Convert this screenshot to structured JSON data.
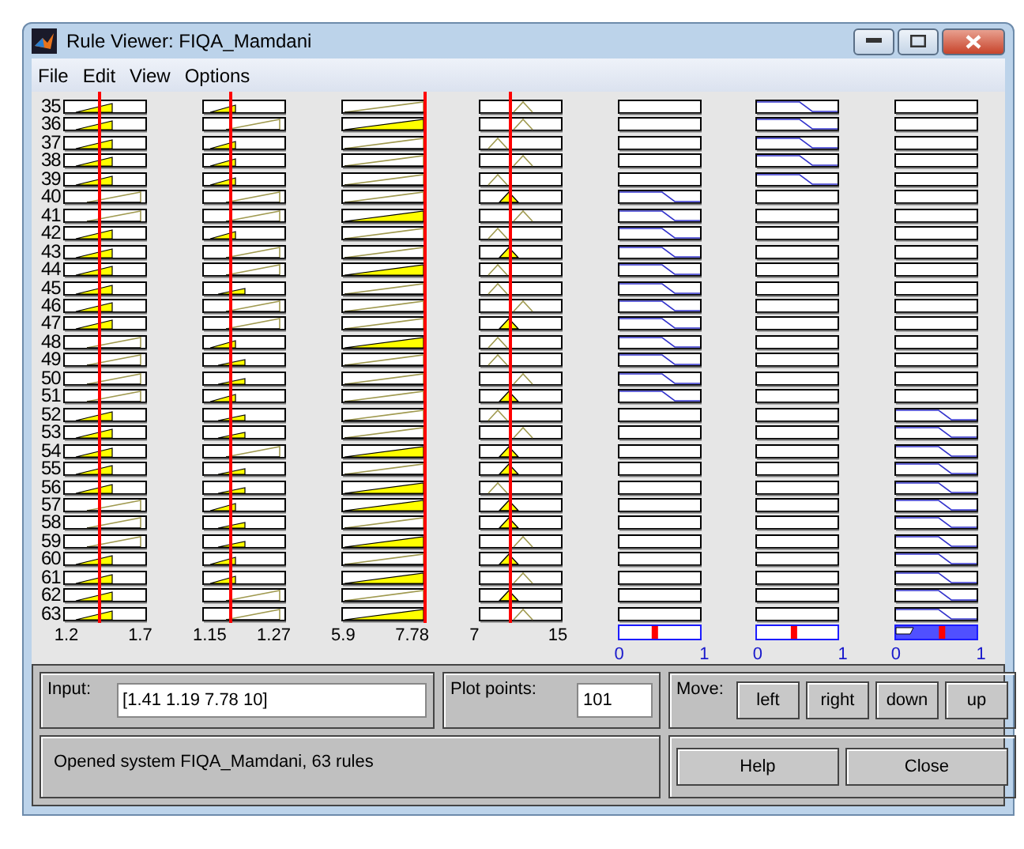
{
  "window": {
    "title": "Rule Viewer: FIQA_Mamdani"
  },
  "menu": [
    "File",
    "Edit",
    "View",
    "Options"
  ],
  "inputs": [
    {
      "min": "1.2",
      "max": "1.7"
    },
    {
      "min": "1.15",
      "max": "1.27"
    },
    {
      "min": "5.9",
      "max": "7.78"
    },
    {
      "min": "7",
      "max": "15"
    }
  ],
  "outputs": [
    {
      "min": "0",
      "max": "1",
      "level": 0.45,
      "filled": false
    },
    {
      "min": "0",
      "max": "1",
      "level": 0.47,
      "filled": false
    },
    {
      "min": "0",
      "max": "1",
      "level": 0.58,
      "filled": true
    }
  ],
  "rules": [
    {
      "number": "35",
      "inputs": [
        {
          "kind": "short",
          "on": true
        },
        {
          "kind": "small",
          "on": true
        },
        {
          "kind": "full",
          "on": false
        },
        {
          "kind": "tri-right",
          "on": false
        }
      ],
      "outputs": [
        {
          "kind": "blank"
        },
        {
          "kind": "falling"
        },
        {
          "kind": "blank"
        }
      ]
    },
    {
      "number": "36",
      "inputs": [
        {
          "kind": "short",
          "on": true
        },
        {
          "kind": "long",
          "on": false
        },
        {
          "kind": "full",
          "on": true
        },
        {
          "kind": "tri-right",
          "on": false
        }
      ],
      "outputs": [
        {
          "kind": "blank"
        },
        {
          "kind": "falling"
        },
        {
          "kind": "blank"
        }
      ]
    },
    {
      "number": "37",
      "inputs": [
        {
          "kind": "short",
          "on": true
        },
        {
          "kind": "small",
          "on": true
        },
        {
          "kind": "full",
          "on": false
        },
        {
          "kind": "tri-left",
          "on": false
        }
      ],
      "outputs": [
        {
          "kind": "blank"
        },
        {
          "kind": "falling"
        },
        {
          "kind": "blank"
        }
      ]
    },
    {
      "number": "38",
      "inputs": [
        {
          "kind": "short",
          "on": true
        },
        {
          "kind": "small",
          "on": true
        },
        {
          "kind": "full",
          "on": false
        },
        {
          "kind": "tri-right",
          "on": false
        }
      ],
      "outputs": [
        {
          "kind": "blank"
        },
        {
          "kind": "falling"
        },
        {
          "kind": "blank"
        }
      ]
    },
    {
      "number": "39",
      "inputs": [
        {
          "kind": "short",
          "on": true
        },
        {
          "kind": "small",
          "on": true
        },
        {
          "kind": "full",
          "on": false
        },
        {
          "kind": "tri-left",
          "on": false
        }
      ],
      "outputs": [
        {
          "kind": "blank"
        },
        {
          "kind": "falling"
        },
        {
          "kind": "blank"
        }
      ]
    },
    {
      "number": "40",
      "inputs": [
        {
          "kind": "long",
          "on": false
        },
        {
          "kind": "long",
          "on": false
        },
        {
          "kind": "full",
          "on": false
        },
        {
          "kind": "tri-mid",
          "on": true
        }
      ],
      "outputs": [
        {
          "kind": "falling"
        },
        {
          "kind": "blank"
        },
        {
          "kind": "blank"
        }
      ]
    },
    {
      "number": "41",
      "inputs": [
        {
          "kind": "long",
          "on": false
        },
        {
          "kind": "long",
          "on": false
        },
        {
          "kind": "full",
          "on": true
        },
        {
          "kind": "tri-right",
          "on": false
        }
      ],
      "outputs": [
        {
          "kind": "falling"
        },
        {
          "kind": "blank"
        },
        {
          "kind": "blank"
        }
      ]
    },
    {
      "number": "42",
      "inputs": [
        {
          "kind": "short",
          "on": true
        },
        {
          "kind": "small",
          "on": true
        },
        {
          "kind": "full",
          "on": false
        },
        {
          "kind": "tri-left",
          "on": false
        }
      ],
      "outputs": [
        {
          "kind": "falling"
        },
        {
          "kind": "blank"
        },
        {
          "kind": "blank"
        }
      ]
    },
    {
      "number": "43",
      "inputs": [
        {
          "kind": "short",
          "on": true
        },
        {
          "kind": "long",
          "on": false
        },
        {
          "kind": "full",
          "on": false
        },
        {
          "kind": "tri-mid",
          "on": true
        }
      ],
      "outputs": [
        {
          "kind": "falling"
        },
        {
          "kind": "blank"
        },
        {
          "kind": "blank"
        }
      ]
    },
    {
      "number": "44",
      "inputs": [
        {
          "kind": "short",
          "on": true
        },
        {
          "kind": "long",
          "on": false
        },
        {
          "kind": "full",
          "on": true
        },
        {
          "kind": "tri-left",
          "on": false
        }
      ],
      "outputs": [
        {
          "kind": "falling"
        },
        {
          "kind": "blank"
        },
        {
          "kind": "blank"
        }
      ]
    },
    {
      "number": "45",
      "inputs": [
        {
          "kind": "short",
          "on": true
        },
        {
          "kind": "mid",
          "on": true
        },
        {
          "kind": "full",
          "on": false
        },
        {
          "kind": "tri-left",
          "on": false
        }
      ],
      "outputs": [
        {
          "kind": "falling"
        },
        {
          "kind": "blank"
        },
        {
          "kind": "blank"
        }
      ]
    },
    {
      "number": "46",
      "inputs": [
        {
          "kind": "short",
          "on": true
        },
        {
          "kind": "long",
          "on": false
        },
        {
          "kind": "full",
          "on": false
        },
        {
          "kind": "tri-right",
          "on": false
        }
      ],
      "outputs": [
        {
          "kind": "falling"
        },
        {
          "kind": "blank"
        },
        {
          "kind": "blank"
        }
      ]
    },
    {
      "number": "47",
      "inputs": [
        {
          "kind": "short",
          "on": true
        },
        {
          "kind": "long",
          "on": false
        },
        {
          "kind": "full",
          "on": false
        },
        {
          "kind": "tri-mid",
          "on": true
        }
      ],
      "outputs": [
        {
          "kind": "falling"
        },
        {
          "kind": "blank"
        },
        {
          "kind": "blank"
        }
      ]
    },
    {
      "number": "48",
      "inputs": [
        {
          "kind": "long",
          "on": false
        },
        {
          "kind": "small",
          "on": true
        },
        {
          "kind": "full",
          "on": true
        },
        {
          "kind": "tri-left",
          "on": false
        }
      ],
      "outputs": [
        {
          "kind": "falling"
        },
        {
          "kind": "blank"
        },
        {
          "kind": "blank"
        }
      ]
    },
    {
      "number": "49",
      "inputs": [
        {
          "kind": "long",
          "on": false
        },
        {
          "kind": "mid",
          "on": true
        },
        {
          "kind": "full",
          "on": false
        },
        {
          "kind": "tri-left",
          "on": false
        }
      ],
      "outputs": [
        {
          "kind": "falling"
        },
        {
          "kind": "blank"
        },
        {
          "kind": "blank"
        }
      ]
    },
    {
      "number": "50",
      "inputs": [
        {
          "kind": "long",
          "on": false
        },
        {
          "kind": "mid",
          "on": true
        },
        {
          "kind": "full",
          "on": false
        },
        {
          "kind": "tri-right",
          "on": false
        }
      ],
      "outputs": [
        {
          "kind": "falling"
        },
        {
          "kind": "blank"
        },
        {
          "kind": "blank"
        }
      ]
    },
    {
      "number": "51",
      "inputs": [
        {
          "kind": "long",
          "on": false
        },
        {
          "kind": "small",
          "on": true
        },
        {
          "kind": "full",
          "on": false
        },
        {
          "kind": "tri-mid",
          "on": true
        }
      ],
      "outputs": [
        {
          "kind": "falling"
        },
        {
          "kind": "blank"
        },
        {
          "kind": "blank"
        }
      ]
    },
    {
      "number": "52",
      "inputs": [
        {
          "kind": "short",
          "on": true
        },
        {
          "kind": "mid",
          "on": true
        },
        {
          "kind": "full",
          "on": false
        },
        {
          "kind": "tri-left",
          "on": false
        }
      ],
      "outputs": [
        {
          "kind": "blank"
        },
        {
          "kind": "blank"
        },
        {
          "kind": "falling"
        }
      ]
    },
    {
      "number": "53",
      "inputs": [
        {
          "kind": "short",
          "on": true
        },
        {
          "kind": "mid",
          "on": true
        },
        {
          "kind": "full",
          "on": false
        },
        {
          "kind": "tri-right",
          "on": false
        }
      ],
      "outputs": [
        {
          "kind": "blank"
        },
        {
          "kind": "blank"
        },
        {
          "kind": "falling"
        }
      ]
    },
    {
      "number": "54",
      "inputs": [
        {
          "kind": "short",
          "on": true
        },
        {
          "kind": "long",
          "on": false
        },
        {
          "kind": "full",
          "on": true
        },
        {
          "kind": "tri-mid",
          "on": true
        }
      ],
      "outputs": [
        {
          "kind": "blank"
        },
        {
          "kind": "blank"
        },
        {
          "kind": "falling"
        }
      ]
    },
    {
      "number": "55",
      "inputs": [
        {
          "kind": "short",
          "on": true
        },
        {
          "kind": "mid",
          "on": true
        },
        {
          "kind": "full",
          "on": false
        },
        {
          "kind": "tri-mid",
          "on": true
        }
      ],
      "outputs": [
        {
          "kind": "blank"
        },
        {
          "kind": "blank"
        },
        {
          "kind": "falling"
        }
      ]
    },
    {
      "number": "56",
      "inputs": [
        {
          "kind": "short",
          "on": true
        },
        {
          "kind": "mid",
          "on": true
        },
        {
          "kind": "full",
          "on": true
        },
        {
          "kind": "tri-left",
          "on": false
        }
      ],
      "outputs": [
        {
          "kind": "blank"
        },
        {
          "kind": "blank"
        },
        {
          "kind": "falling"
        }
      ]
    },
    {
      "number": "57",
      "inputs": [
        {
          "kind": "long",
          "on": false
        },
        {
          "kind": "small",
          "on": true
        },
        {
          "kind": "full",
          "on": true
        },
        {
          "kind": "tri-mid",
          "on": true
        }
      ],
      "outputs": [
        {
          "kind": "blank"
        },
        {
          "kind": "blank"
        },
        {
          "kind": "falling"
        }
      ]
    },
    {
      "number": "58",
      "inputs": [
        {
          "kind": "long",
          "on": false
        },
        {
          "kind": "mid",
          "on": true
        },
        {
          "kind": "full",
          "on": false
        },
        {
          "kind": "tri-mid",
          "on": true
        }
      ],
      "outputs": [
        {
          "kind": "blank"
        },
        {
          "kind": "blank"
        },
        {
          "kind": "falling"
        }
      ]
    },
    {
      "number": "59",
      "inputs": [
        {
          "kind": "long",
          "on": false
        },
        {
          "kind": "mid",
          "on": true
        },
        {
          "kind": "full",
          "on": true
        },
        {
          "kind": "tri-right",
          "on": false
        }
      ],
      "outputs": [
        {
          "kind": "blank"
        },
        {
          "kind": "blank"
        },
        {
          "kind": "falling"
        }
      ]
    },
    {
      "number": "60",
      "inputs": [
        {
          "kind": "short",
          "on": true
        },
        {
          "kind": "small",
          "on": true
        },
        {
          "kind": "full",
          "on": false
        },
        {
          "kind": "tri-mid",
          "on": true
        }
      ],
      "outputs": [
        {
          "kind": "blank"
        },
        {
          "kind": "blank"
        },
        {
          "kind": "falling"
        }
      ]
    },
    {
      "number": "61",
      "inputs": [
        {
          "kind": "short",
          "on": true
        },
        {
          "kind": "small",
          "on": true
        },
        {
          "kind": "full",
          "on": true
        },
        {
          "kind": "tri-right",
          "on": false
        }
      ],
      "outputs": [
        {
          "kind": "blank"
        },
        {
          "kind": "blank"
        },
        {
          "kind": "falling"
        }
      ]
    },
    {
      "number": "62",
      "inputs": [
        {
          "kind": "short",
          "on": true
        },
        {
          "kind": "long",
          "on": false
        },
        {
          "kind": "full",
          "on": false
        },
        {
          "kind": "tri-mid",
          "on": true
        }
      ],
      "outputs": [
        {
          "kind": "blank"
        },
        {
          "kind": "blank"
        },
        {
          "kind": "falling"
        }
      ]
    },
    {
      "number": "63",
      "inputs": [
        {
          "kind": "short",
          "on": true
        },
        {
          "kind": "long",
          "on": false
        },
        {
          "kind": "full",
          "on": true
        },
        {
          "kind": "tri-right",
          "on": false
        }
      ],
      "outputs": [
        {
          "kind": "blank"
        },
        {
          "kind": "blank"
        },
        {
          "kind": "falling"
        }
      ]
    }
  ],
  "input_field": {
    "label": "Input:",
    "value": "[1.41 1.19 7.78 10]"
  },
  "plot_points": {
    "label": "Plot points:",
    "value": "101"
  },
  "move": {
    "label": "Move:",
    "buttons": [
      "left",
      "right",
      "down",
      "up"
    ]
  },
  "status": "Opened system FIQA_Mamdani, 63 rules",
  "buttons": [
    "Help",
    "Close"
  ]
}
